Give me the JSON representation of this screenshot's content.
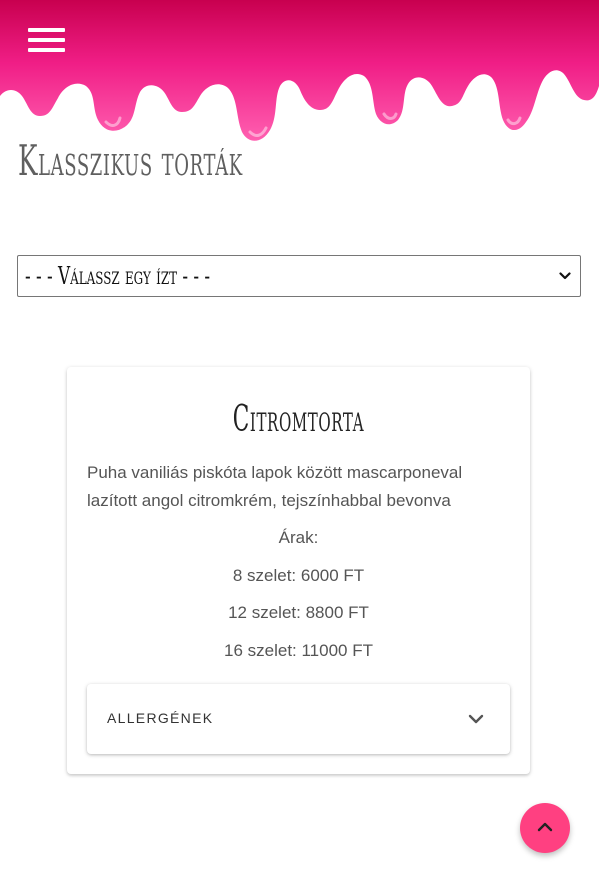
{
  "header": {
    "menu_icon": "hamburger-menu-icon",
    "drip_color": "#e8177a"
  },
  "page": {
    "title": "Klasszikus torták"
  },
  "flavor_select": {
    "selected": "- - - Válassz egy ízt - - -",
    "icon": "chevron-down-icon"
  },
  "cake": {
    "title": "Citromtorta",
    "description": "Puha vaniliás piskóta lapok között mascarponeval lazított angol citromkrém, tejszínhabbal bevonva",
    "prices_label": "Árak:",
    "prices": [
      "8 szelet: 6000 FT",
      "12 szelet: 8800 FT",
      "16 szelet: 11000 FT"
    ],
    "allergens_label": "ALLERGÉNEK",
    "allergens_icon": "chevron-down-icon"
  },
  "fab": {
    "icon": "chevron-up-icon",
    "color": "#ff4081"
  }
}
